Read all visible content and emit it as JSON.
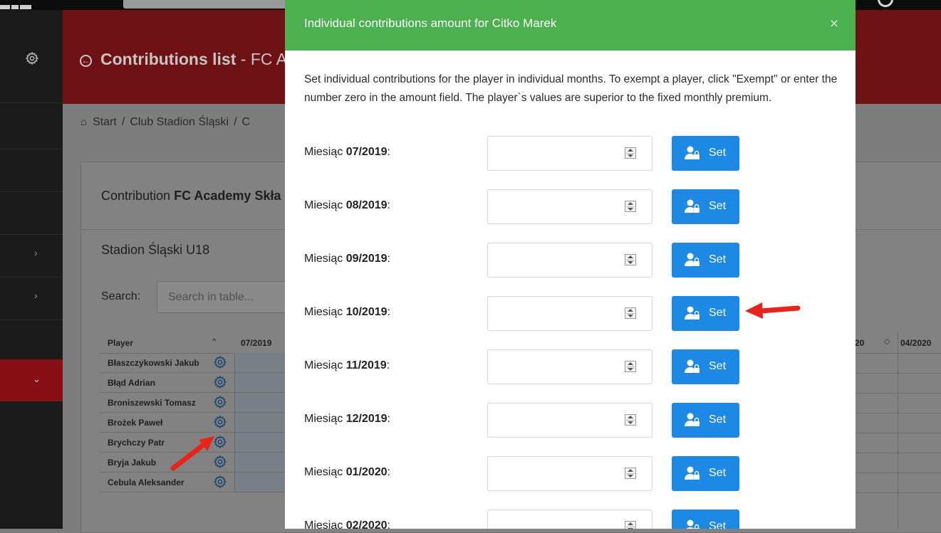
{
  "background": {
    "page_title": "Contributions list",
    "page_title_rest": "- FC A",
    "breadcrumb": [
      "Start",
      "Club Stadion Śląski",
      "C"
    ],
    "card_title_prefix": "Contribution",
    "card_title_bold": "FC Academy Skła",
    "team_name": "Stadion Śląski U18",
    "search_label": "Search:",
    "search_placeholder": "Search in table...",
    "table": {
      "col_player": "Player",
      "col_month": "07/2019",
      "rows": [
        "Błaszczykowski Jakub",
        "Błąd Adrian",
        "Broniszewski Tomasz",
        "Brożek Paweł",
        "Brychczy Patr",
        "Bryja Jakub",
        "Cebula Aleksander"
      ]
    },
    "right_col_partial": "20",
    "right_col_last": "04/2020"
  },
  "modal": {
    "title": "Individual contributions amount for Citko Marek",
    "close_symbol": "×",
    "description": "Set individual contributions for the player in individual months. To exempt a player, click \"Exempt\" or enter the number zero in the amount field. The player`s values are superior to the fixed monthly premium.",
    "month_prefix": "Miesiąc",
    "set_label": "Set",
    "months": [
      {
        "month": "07/2019",
        "value": ""
      },
      {
        "month": "08/2019",
        "value": ""
      },
      {
        "month": "09/2019",
        "value": ""
      },
      {
        "month": "10/2019",
        "value": ""
      },
      {
        "month": "11/2019",
        "value": ""
      },
      {
        "month": "12/2019",
        "value": ""
      },
      {
        "month": "01/2020",
        "value": ""
      },
      {
        "month": "02/2020",
        "value": ""
      }
    ]
  },
  "colors": {
    "modal_header": "#4caf50",
    "button": "#1e88e5",
    "annotation_arrow": "#e8231a"
  }
}
